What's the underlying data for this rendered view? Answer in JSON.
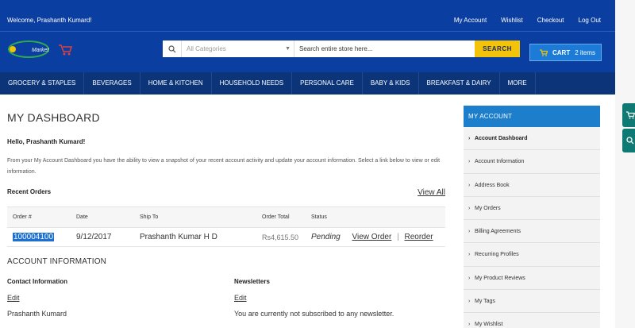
{
  "header": {
    "welcome": "Welcome, Prashanth Kumard!",
    "links": [
      "My Account",
      "Wishlist",
      "Checkout",
      "Log Out"
    ],
    "logo_text": "Market",
    "search": {
      "category_placeholder": "All Categories",
      "query_placeholder": "Search entire store here...",
      "button": "SEARCH"
    },
    "cart": {
      "label": "CART",
      "count": "2 items"
    }
  },
  "nav": [
    "GROCERY & STAPLES",
    "BEVERAGES",
    "HOME & KITCHEN",
    "HOUSEHOLD NEEDS",
    "PERSONAL CARE",
    "BABY & KIDS",
    "BREAKFAST & DAIRY",
    "MORE"
  ],
  "main": {
    "title": "MY DASHBOARD",
    "hello": "Hello, Prashanth Kumard!",
    "intro": "From your My Account Dashboard you have the ability to view a snapshot of your recent account activity and update your account information. Select a link below to view or edit information.",
    "recent_orders": {
      "title": "Recent Orders",
      "view_all": "View All",
      "columns": [
        "Order #",
        "Date",
        "Ship To",
        "Order Total",
        "Status"
      ],
      "rows": [
        {
          "order": "100004100",
          "date": "9/12/2017",
          "ship_to": "Prashanth Kumar H D",
          "total": "Rs4,615.50",
          "status": "Pending",
          "view": "View Order",
          "reorder": "Reorder"
        }
      ]
    },
    "account_info": {
      "title": "ACCOUNT INFORMATION",
      "contact": {
        "title": "Contact Information",
        "edit": "Edit",
        "value": "Prashanth Kumard"
      },
      "newsletters": {
        "title": "Newsletters",
        "edit": "Edit",
        "value": "You are currently not subscribed to any newsletter."
      }
    }
  },
  "sidebar": {
    "title": "MY ACCOUNT",
    "items": [
      "Account Dashboard",
      "Account Information",
      "Address Book",
      "My Orders",
      "Billing Agreements",
      "Recurring Profiles",
      "My Product Reviews",
      "My Tags",
      "My Wishlist"
    ]
  },
  "colors": {
    "header": "#0b3ea1",
    "nav": "#0c3478",
    "accent": "#1d7ecb",
    "search_button": "#f3c309"
  }
}
